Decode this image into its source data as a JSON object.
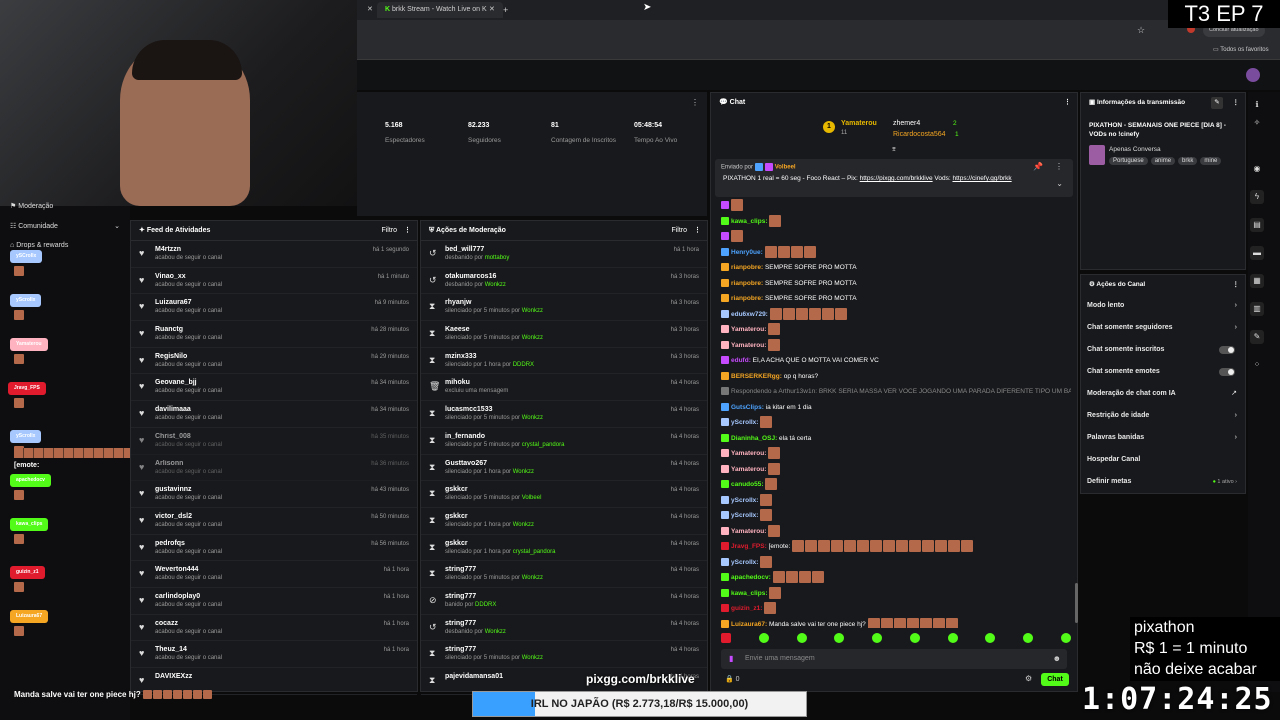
{
  "browser": {
    "tab1": "brkk Stream - Watch Live on K",
    "update_btn": "Concluir atualização",
    "bookmarks": "Todos os favoritos"
  },
  "overlay": {
    "episode": "T3 EP 7",
    "promo_title": "pixathon",
    "promo_line1": "R$ 1 = 1 minuto",
    "promo_line2": "não deixe acabar",
    "timer": "1:07:24:25",
    "goal": "IRL NO JAPÃO (R$ 2.773,18/R$ 15.000,00)",
    "goal_progress": 0.185,
    "pix_url": "pixgg.com/brkklive",
    "chat_msg": "Manda salve vai ter one piece hj?"
  },
  "leftnav": {
    "moderation": "Moderação",
    "community": "Comunidade",
    "drops": "Drops & rewards"
  },
  "left_pills": [
    {
      "label": "ySCroIlx",
      "color": "#a6c8ff"
    },
    {
      "label": "yScroIlx",
      "color": "#a6c8ff"
    },
    {
      "label": "Yamaterou",
      "color": "#ffb3c0"
    },
    {
      "label": "Jravg_FPS",
      "color": "#e11b2e"
    },
    {
      "label": "yScroIlx",
      "color": "#a6c8ff"
    },
    {
      "label": "apachedocv",
      "color": "#53fc18"
    },
    {
      "label": "kawa_clips",
      "color": "#53fc18"
    },
    {
      "label": "guizin_z1",
      "color": "#e11b2e"
    },
    {
      "label": "Luizaura67",
      "color": "#f5a623"
    }
  ],
  "left_emote_label": "[emote:",
  "stats": [
    {
      "value": "5.168",
      "label": "Espectadores"
    },
    {
      "value": "82.233",
      "label": "Seguidores"
    },
    {
      "value": "81",
      "label": "Contagem de Inscritos"
    },
    {
      "value": "05:48:54",
      "label": "Tempo Ao Vivo"
    }
  ],
  "feed": {
    "title": "Feed de Atividades",
    "filter": "Filtro",
    "items": [
      {
        "name": "M4rtzzn",
        "sub": "acabou de seguir o canal",
        "time": "há 1 segundo"
      },
      {
        "name": "Vinao_xx",
        "sub": "acabou de seguir o canal",
        "time": "há 1 minuto"
      },
      {
        "name": "Luizaura67",
        "sub": "acabou de seguir o canal",
        "time": "há 9 minutos"
      },
      {
        "name": "Ruanctg",
        "sub": "acabou de seguir o canal",
        "time": "há 28 minutos"
      },
      {
        "name": "RegisNilo",
        "sub": "acabou de seguir o canal",
        "time": "há 29 minutos"
      },
      {
        "name": "Geovane_bjj",
        "sub": "acabou de seguir o canal",
        "time": "há 34 minutos"
      },
      {
        "name": "davilimaaa",
        "sub": "acabou de seguir o canal",
        "time": "há 34 minutos"
      },
      {
        "name": "Christ_008",
        "sub": "acabou de seguir o canal",
        "time": "há 35 minutos"
      },
      {
        "name": "Arlisonn",
        "sub": "acabou de seguir o canal",
        "time": "há 36 minutos"
      },
      {
        "name": "gustavinnz",
        "sub": "acabou de seguir o canal",
        "time": "há 43 minutos"
      },
      {
        "name": "victor_dsl2",
        "sub": "acabou de seguir o canal",
        "time": "há 50 minutos"
      },
      {
        "name": "pedrofqs",
        "sub": "acabou de seguir o canal",
        "time": "há 56 minutos"
      },
      {
        "name": "Weverton444",
        "sub": "acabou de seguir o canal",
        "time": "há 1 hora"
      },
      {
        "name": "carlindoplay0",
        "sub": "acabou de seguir o canal",
        "time": "há 1 hora"
      },
      {
        "name": "cocazz",
        "sub": "acabou de seguir o canal",
        "time": "há 1 hora"
      },
      {
        "name": "Theuz_14",
        "sub": "acabou de seguir o canal",
        "time": "há 1 hora"
      },
      {
        "name": "DAVIXEXzz",
        "sub": "",
        "time": ""
      }
    ]
  },
  "mod": {
    "title": "Ações de Moderação",
    "filter": "Filtro",
    "items": [
      {
        "icon": "↺",
        "name": "bed_will777",
        "pre": "desbanido por ",
        "by": "mottaboy",
        "time": "há 1 hora"
      },
      {
        "icon": "↺",
        "name": "otakumarcos16",
        "pre": "desbanido por ",
        "by": "Wonkzz",
        "time": "há 3 horas"
      },
      {
        "icon": "⧗",
        "name": "rhyanjw",
        "pre": "silenciado por 5 minutos por ",
        "by": "Wonkzz",
        "time": "há 3 horas"
      },
      {
        "icon": "⧗",
        "name": "Kaeese",
        "pre": "silenciado por 5 minutos por ",
        "by": "Wonkzz",
        "time": "há 3 horas"
      },
      {
        "icon": "⧗",
        "name": "mzinx333",
        "pre": "silenciado por 1 hora por ",
        "by": "DDDRX",
        "time": "há 3 horas"
      },
      {
        "icon": "🗑",
        "name": "mihoku",
        "pre": "excluiu uma mensagem",
        "by": "",
        "time": "há 4 horas"
      },
      {
        "icon": "⧗",
        "name": "lucasmcc1533",
        "pre": "silenciado por 5 minutos por ",
        "by": "Wonkzz",
        "time": "há 4 horas"
      },
      {
        "icon": "⧗",
        "name": "in_fernando",
        "pre": "silenciado por 5 minutos por ",
        "by": "crystal_pandora",
        "time": "há 4 horas"
      },
      {
        "icon": "⧗",
        "name": "Gusttavo267",
        "pre": "silenciado por 1 hora por ",
        "by": "Wonkzz",
        "time": "há 4 horas"
      },
      {
        "icon": "⧗",
        "name": "gskkcr",
        "pre": "silenciado por 5 minutos por ",
        "by": "Volbeel",
        "time": "há 4 horas"
      },
      {
        "icon": "⧗",
        "name": "gskkcr",
        "pre": "silenciado por 1 hora por ",
        "by": "Wonkzz",
        "time": "há 4 horas"
      },
      {
        "icon": "⧗",
        "name": "gskkcr",
        "pre": "silenciado por 1 hora por ",
        "by": "crystal_pandora",
        "time": "há 4 horas"
      },
      {
        "icon": "⧗",
        "name": "string777",
        "pre": "silenciado por 5 minutos por ",
        "by": "Wonkzz",
        "time": "há 4 horas"
      },
      {
        "icon": "⊘",
        "name": "string777",
        "pre": "banido por ",
        "by": "DDDRX",
        "time": "há 4 horas"
      },
      {
        "icon": "↺",
        "name": "string777",
        "pre": "desbanido por ",
        "by": "Wonkzz",
        "time": "há 4 horas"
      },
      {
        "icon": "⧗",
        "name": "string777",
        "pre": "silenciado por 5 minutos por ",
        "by": "Wonkzz",
        "time": "há 4 horas"
      },
      {
        "icon": "⧗",
        "name": "pajevidamansa01",
        "pre": "",
        "by": "",
        "time": "há 4 horas"
      }
    ]
  },
  "chat": {
    "title": "Chat",
    "leader1": "Yamaterou",
    "leader1_count": "11",
    "leader2": "zhemer4",
    "leader2_count": "2",
    "leader3": "Ricardocosta564",
    "leader3_count": "1",
    "pinned_by_label": "Enviado por",
    "pinned_by": "Volbeel",
    "pinned_text": "PIXATHON 1 real = 60 seg - Foco React – Pix: ",
    "pinned_link1": "https://pixgg.com/brkklive",
    "pinned_mid": " Vods: ",
    "pinned_link2": "https://cinefy.gg/brkk",
    "messages": [
      {
        "user": "",
        "color": "#c64bff",
        "text": "",
        "emotes": 1
      },
      {
        "user": "kawa_clips:",
        "color": "#53fc18",
        "text": "",
        "emotes": 1
      },
      {
        "user": "",
        "color": "#c64bff",
        "text": "",
        "emotes": 1
      },
      {
        "user": "Henry0ue:",
        "color": "#4da3ff",
        "text": "",
        "emotes": 4
      },
      {
        "user": "rianpobre:",
        "color": "#f5a623",
        "text": "SEMPRE SOFRE PRO MOTTA",
        "emotes": 0
      },
      {
        "user": "rianpobre:",
        "color": "#f5a623",
        "text": "SEMPRE SOFRE PRO MOTTA",
        "emotes": 0
      },
      {
        "user": "rianpobre:",
        "color": "#f5a623",
        "text": "SEMPRE SOFRE PRO MOTTA",
        "emotes": 0
      },
      {
        "user": "edu6xw729:",
        "color": "#a6c8ff",
        "text": "",
        "emotes": 6
      },
      {
        "user": "Yamaterou:",
        "color": "#ffb3c0",
        "text": "",
        "emotes": 1
      },
      {
        "user": "Yamaterou:",
        "color": "#ffb3c0",
        "text": "",
        "emotes": 1
      },
      {
        "user": "edufd:",
        "color": "#c64bff",
        "text": "EI,A ACHA QUE O MOTTA VAI COMER VC",
        "emotes": 0
      },
      {
        "user": "BERSERKERgg:",
        "color": "#f5a623",
        "text": "op q horas?",
        "emotes": 0
      },
      {
        "user": "",
        "color": "#777",
        "text": "Respondendo a Arthur13w1n: BRKK SERIA MASSA VER VOCE JOGANDO UMA PARADA DIFERENTE TIPO UM BALDU...",
        "emotes": 0
      },
      {
        "user": "GutsClips:",
        "color": "#4da3ff",
        "text": "ia kitar em 1 dia",
        "emotes": 0
      },
      {
        "user": "yScroIlx:",
        "color": "#a6c8ff",
        "text": "",
        "emotes": 1
      },
      {
        "user": "Dianinha_OSJ:",
        "color": "#53fc18",
        "text": "ela tá certa",
        "emotes": 0
      },
      {
        "user": "Yamaterou:",
        "color": "#ffb3c0",
        "text": "",
        "emotes": 1
      },
      {
        "user": "Yamaterou:",
        "color": "#ffb3c0",
        "text": "",
        "emotes": 1
      },
      {
        "user": "canudo55:",
        "color": "#53fc18",
        "text": "",
        "emotes": 1
      },
      {
        "user": "yScroIlx:",
        "color": "#a6c8ff",
        "text": "",
        "emotes": 1
      },
      {
        "user": "yScroIlx:",
        "color": "#a6c8ff",
        "text": "",
        "emotes": 1
      },
      {
        "user": "Yamaterou:",
        "color": "#ffb3c0",
        "text": "",
        "emotes": 1
      },
      {
        "user": "Jravg_FPS:",
        "color": "#e11b2e",
        "text": "[emote:",
        "emotes": 14
      },
      {
        "user": "yScroIlx:",
        "color": "#a6c8ff",
        "text": "",
        "emotes": 1
      },
      {
        "user": "apachedocv:",
        "color": "#53fc18",
        "text": "",
        "emotes": 4
      },
      {
        "user": "kawa_clips:",
        "color": "#53fc18",
        "text": "",
        "emotes": 1
      },
      {
        "user": "guizin_z1:",
        "color": "#e11b2e",
        "text": "",
        "emotes": 1
      },
      {
        "user": "Luizaura67:",
        "color": "#f5a623",
        "text": "Manda salve vai ter one piece hj?",
        "emotes": 7
      }
    ],
    "input_placeholder": "Envie uma mensagem",
    "viewers": "0",
    "send": "Chat"
  },
  "info": {
    "title": "Informações da transmissão",
    "stream_title": "PIXATHON - SEMANAIS ONE PIECE [DIA 8] - VODs no !cinefy",
    "category": "Apenas Conversa",
    "tags": [
      "Portuguese",
      "anime",
      "brkk",
      "mine"
    ]
  },
  "actions": {
    "title": "Ações do Canal",
    "items": [
      {
        "label": "Modo lento",
        "right": "›"
      },
      {
        "label": "Chat somente seguidores",
        "right": "›"
      },
      {
        "label": "Chat somente inscritos",
        "right": "toggle"
      },
      {
        "label": "Chat somente emotes",
        "right": "toggle"
      },
      {
        "label": "Moderação de chat com IA",
        "right": "↗"
      },
      {
        "label": "Restrição de idade",
        "right": "›"
      },
      {
        "label": "Palavras banidas",
        "right": "›"
      },
      {
        "label": "Hospedar Canal",
        "right": ""
      },
      {
        "label": "Definir metas",
        "right": "1 ativo ›"
      }
    ]
  }
}
